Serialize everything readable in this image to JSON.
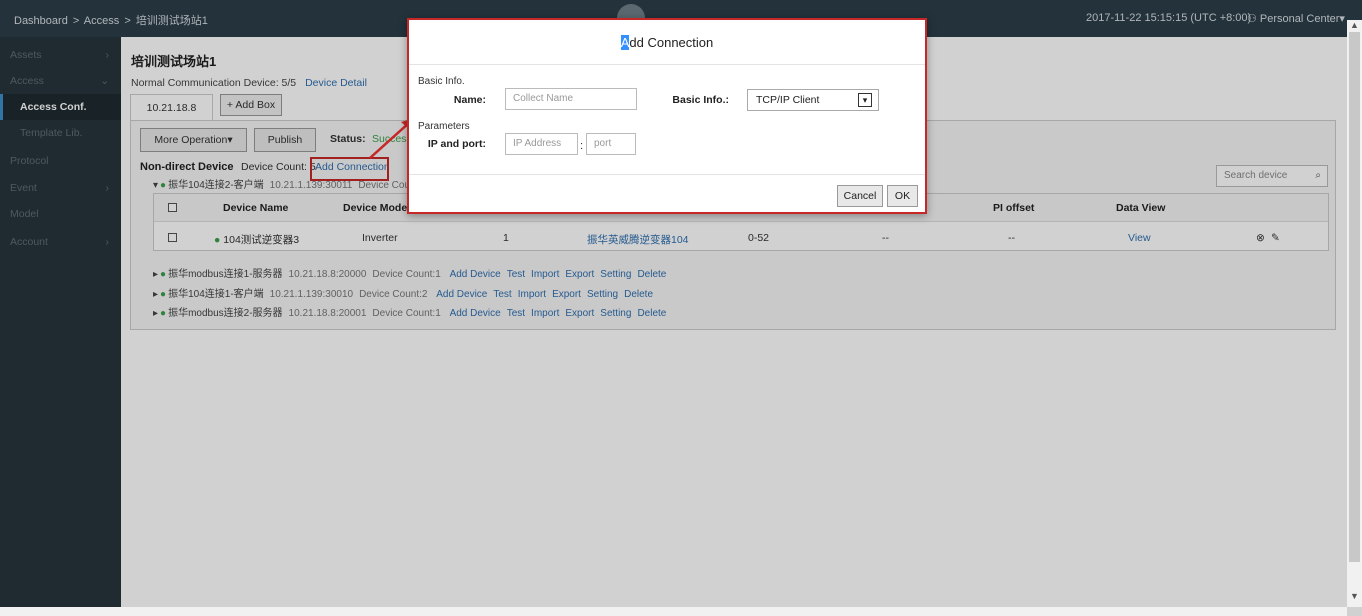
{
  "topbar": {
    "breadcrumb": [
      "Dashboard",
      ">",
      "Access",
      ">",
      "培训测试场站1"
    ],
    "datetime": "2017-11-22 15:15:15 (UTC +8:00)",
    "user_menu": "Personal Center"
  },
  "sidebar": {
    "items": [
      {
        "label": "Assets",
        "chevron": "›"
      },
      {
        "label": "Access",
        "chevron": "⌄"
      },
      {
        "label": "Access Conf."
      },
      {
        "label": "Template Lib."
      },
      {
        "label": "Protocol"
      },
      {
        "label": "Event",
        "chevron": "›"
      },
      {
        "label": "Model"
      },
      {
        "label": "Account",
        "chevron": "›"
      }
    ]
  },
  "main": {
    "title": "培训测试场站1",
    "comm_label": "Normal Communication Device: 5/5",
    "device_detail": "Device Detail",
    "tab": "10.21.18.8",
    "add_box": "+ Add Box",
    "more_operation": "More Operation",
    "publish": "Publish",
    "status_label": "Status:",
    "status_value": "Success",
    "nd_title": "Non-direct Device",
    "nd_count": "Device Count: 5",
    "add_connection": "Add Connection",
    "search_placeholder": "Search device",
    "first_group": {
      "name": "振华104连接2-客户端",
      "addr": "10.21.1.139:30011",
      "count": "Device Count:"
    },
    "table": {
      "headers": [
        "Device Name",
        "Device Model",
        "PI offset",
        "Data View"
      ],
      "row": {
        "name": "104测试逆变器3",
        "model": "Inverter",
        "addr": "1",
        "template": "振华英威腾逆变器104",
        "range": "0-52",
        "c1": "--",
        "pi": "--",
        "view": "View"
      }
    },
    "groups": [
      {
        "name": "振华modbus连接1-服务器",
        "addr": "10.21.18.8:20000",
        "count": "Device Count:1"
      },
      {
        "name": "振华104连接1-客户端",
        "addr": "10.21.1.139:30010",
        "count": "Device Count:2"
      },
      {
        "name": "振华modbus连接2-服务器",
        "addr": "10.21.18.8:20001",
        "count": "Device Count:1"
      }
    ],
    "group_actions": [
      "Add Device",
      "Test",
      "Import",
      "Export",
      "Setting",
      "Delete"
    ]
  },
  "modal": {
    "title_sel": "A",
    "title_rest": "dd Connection",
    "basic_info": "Basic Info.",
    "name_label": "Name:",
    "name_placeholder": "Collect Name",
    "type_label": "Basic Info.:",
    "type_value": "TCP/IP Client",
    "parameters": "Parameters",
    "ip_label": "IP and port:",
    "ip_placeholder": "IP Address",
    "port_placeholder": "port",
    "cancel": "Cancel",
    "ok": "OK"
  },
  "colors": {
    "accent": "#2f6fb0",
    "highlight": "#c62828",
    "topbar": "#2b3d48",
    "sidebar": "#27343c"
  }
}
